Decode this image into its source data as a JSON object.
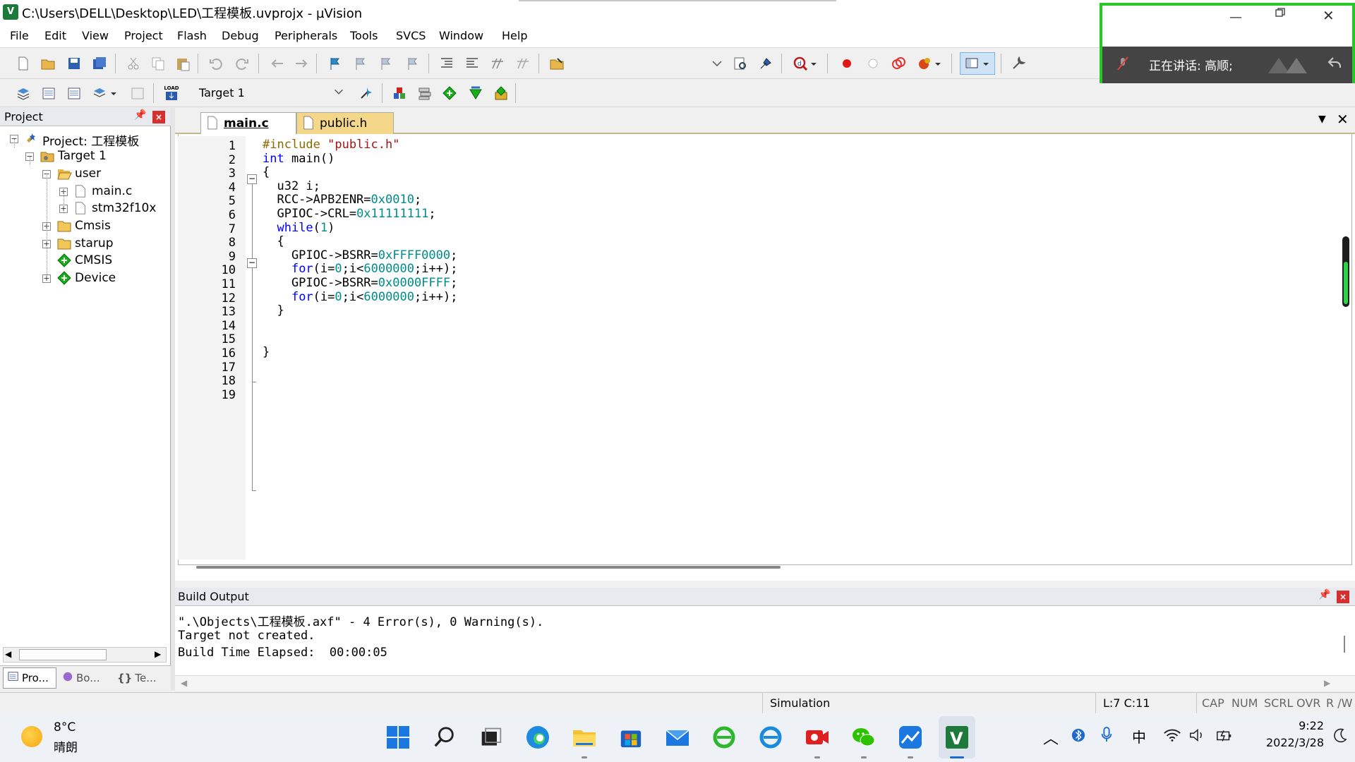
{
  "window": {
    "title": "C:\\Users\\DELL\\Desktop\\LED\\工程模板.uvprojx - µVision",
    "app_icon_text": "V"
  },
  "menu": [
    "File",
    "Edit",
    "View",
    "Project",
    "Flash",
    "Debug",
    "Peripherals",
    "Tools",
    "SVCS",
    "Window",
    "Help"
  ],
  "toolbar2": {
    "load_label": "LOAD",
    "target_select": "Target 1"
  },
  "meeting": {
    "speaking_text": "正在讲话: 高顺;"
  },
  "project_panel": {
    "title": "Project",
    "tree": [
      {
        "label": "Project: 工程模板",
        "level": 0,
        "icon": "project-icon",
        "expander": "−"
      },
      {
        "label": "Target 1",
        "level": 1,
        "icon": "target-folder-icon",
        "expander": "−"
      },
      {
        "label": "user",
        "level": 2,
        "icon": "folder-open-icon",
        "expander": "−"
      },
      {
        "label": "main.c",
        "level": 3,
        "icon": "file-icon",
        "expander": "+"
      },
      {
        "label": "stm32f10x",
        "level": 3,
        "icon": "file-icon",
        "expander": "+"
      },
      {
        "label": "Cmsis",
        "level": 2,
        "icon": "folder-icon",
        "expander": "+"
      },
      {
        "label": "starup",
        "level": 2,
        "icon": "folder-icon",
        "expander": "+"
      },
      {
        "label": "CMSIS",
        "level": 2,
        "icon": "component-icon",
        "expander": ""
      },
      {
        "label": "Device",
        "level": 2,
        "icon": "component-icon",
        "expander": "+"
      }
    ],
    "bottom_tabs": [
      "Pro...",
      "Bo...",
      "Te..."
    ]
  },
  "editor": {
    "tabs": [
      {
        "label": "main.c",
        "active": true
      },
      {
        "label": "public.h",
        "active": false
      }
    ],
    "line_numbers": [
      "1",
      "2",
      "3",
      "4",
      "5",
      "6",
      "7",
      "8",
      "9",
      "10",
      "11",
      "12",
      "13",
      "14",
      "15",
      "16",
      "17",
      "18",
      "19"
    ],
    "code_lines": [
      [
        {
          "t": "#include ",
          "c": "pp"
        },
        {
          "t": "\"public.h\"",
          "c": "str"
        }
      ],
      [
        {
          "t": "int",
          "c": "kw"
        },
        {
          "t": " main()",
          "c": ""
        }
      ],
      [
        {
          "t": "{",
          "c": ""
        }
      ],
      [
        {
          "t": "  u32 i;",
          "c": ""
        }
      ],
      [
        {
          "t": "  RCC->APB2ENR=",
          "c": ""
        },
        {
          "t": "0x0010",
          "c": "num"
        },
        {
          "t": ";",
          "c": ""
        }
      ],
      [
        {
          "t": "  GPIOC->CRL=",
          "c": ""
        },
        {
          "t": "0x11111111",
          "c": "num"
        },
        {
          "t": ";",
          "c": ""
        }
      ],
      [
        {
          "t": "  ",
          "c": ""
        },
        {
          "t": "while",
          "c": "kw"
        },
        {
          "t": "(",
          "c": ""
        },
        {
          "t": "1",
          "c": "num"
        },
        {
          "t": ")",
          "c": ""
        }
      ],
      [
        {
          "t": "  {",
          "c": ""
        }
      ],
      [
        {
          "t": "    GPIOC->BSRR=",
          "c": ""
        },
        {
          "t": "0xFFFF0000",
          "c": "num"
        },
        {
          "t": ";",
          "c": ""
        }
      ],
      [
        {
          "t": "    ",
          "c": ""
        },
        {
          "t": "for",
          "c": "kw"
        },
        {
          "t": "(i=",
          "c": ""
        },
        {
          "t": "0",
          "c": "num"
        },
        {
          "t": ";i<",
          "c": ""
        },
        {
          "t": "6000000",
          "c": "num"
        },
        {
          "t": ";i++);",
          "c": ""
        }
      ],
      [
        {
          "t": "    GPIOC->BSRR=",
          "c": ""
        },
        {
          "t": "0x0000FFFF",
          "c": "num"
        },
        {
          "t": ";",
          "c": ""
        }
      ],
      [
        {
          "t": "    ",
          "c": ""
        },
        {
          "t": "for",
          "c": "kw"
        },
        {
          "t": "(i=",
          "c": ""
        },
        {
          "t": "0",
          "c": "num"
        },
        {
          "t": ";i<",
          "c": ""
        },
        {
          "t": "6000000",
          "c": "num"
        },
        {
          "t": ";i++);",
          "c": ""
        }
      ],
      [
        {
          "t": "  }",
          "c": ""
        }
      ],
      [],
      [],
      [
        {
          "t": "}",
          "c": ""
        }
      ],
      [],
      [],
      []
    ]
  },
  "build_output": {
    "title": "Build Output",
    "lines": [
      "\".\\Objects\\工程模板.axf\" - 4 Error(s), 0 Warning(s).",
      "Target not created.",
      "Build Time Elapsed:  00:00:05"
    ]
  },
  "statusbar": {
    "mode": "Simulation",
    "cursor": "L:7 C:11",
    "indicators": [
      "CAP",
      "NUM",
      "SCRL",
      "OVR",
      "R /W"
    ]
  },
  "taskbar": {
    "weather_temp": "8°C",
    "weather_desc": "晴朗",
    "ime": "中",
    "time": "9:22",
    "date": "2022/3/28"
  },
  "colors": {
    "keyword": "#0000ff",
    "number": "#008b8b",
    "preprocessor": "#8b6a00",
    "string": "#a31515",
    "meeting_border": "#26c826"
  }
}
